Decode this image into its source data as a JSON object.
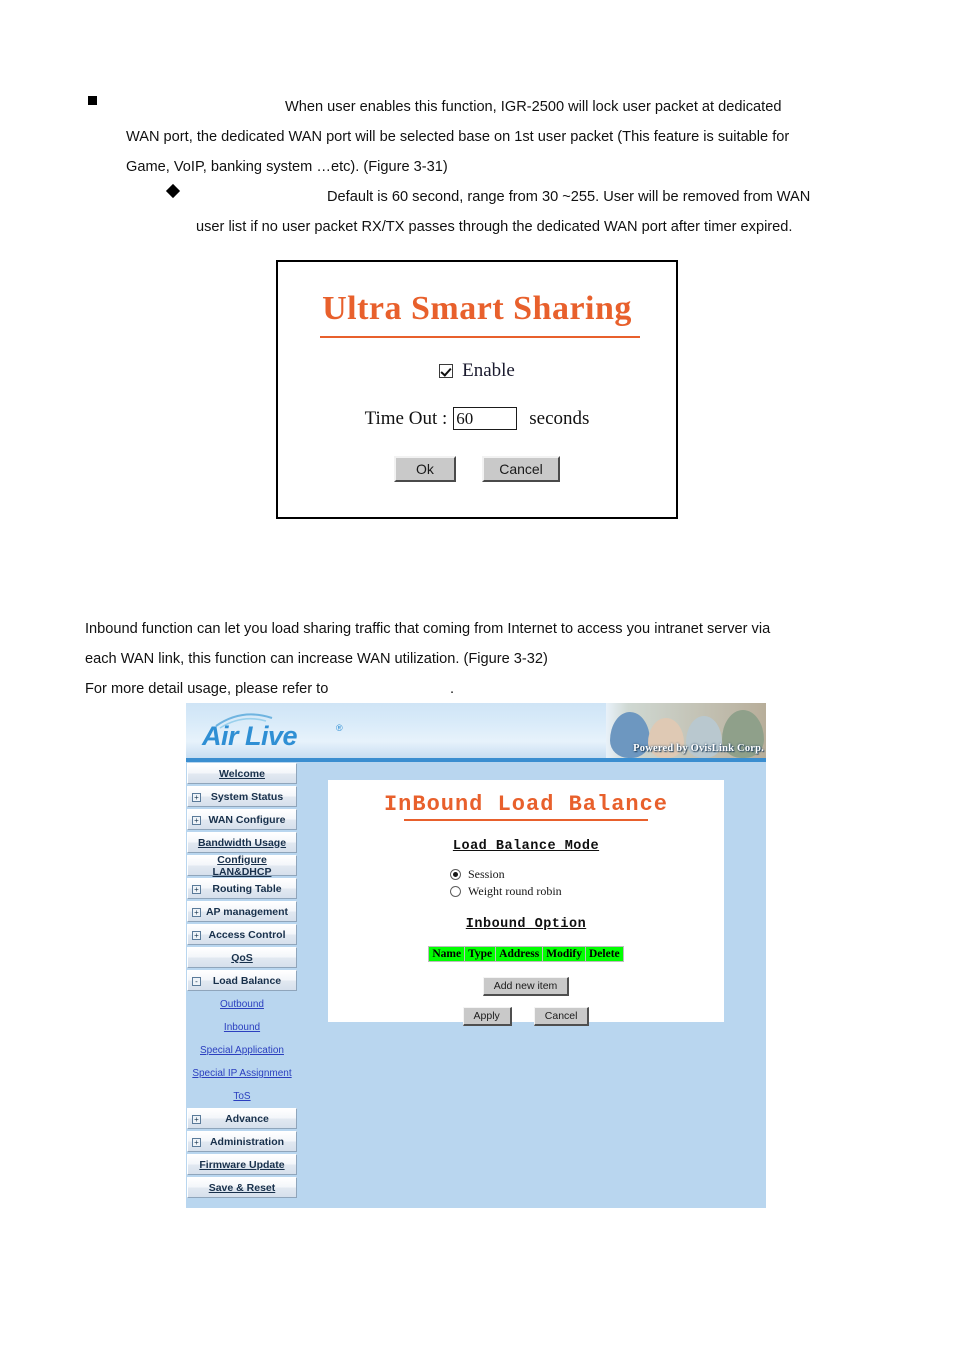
{
  "document": {
    "bullet1": {
      "marker": "square-bullet",
      "line1": "When user enables this function, IGR-2500 will lock user packet at dedicated",
      "line2": "WAN port, the dedicated WAN port will be selected base on 1st user packet (This feature is suitable for",
      "line3": "Game, VoIP, banking system …etc). (Figure 3-31)"
    },
    "bullet2": {
      "marker": "diamond-bullet",
      "line1": "Default is 60 second, range from 30 ~255. User will be removed from WAN",
      "line2": "user list if no user packet RX/TX passes through the dedicated WAN port after timer expired."
    },
    "paragraph2": {
      "line1": "Inbound function can let you load sharing traffic that coming from Internet to access you intranet server via",
      "line2": "each WAN link, this function can increase WAN utilization. (Figure 3-32)",
      "line3": "For more detail usage, please refer to",
      "line3_tail": "."
    }
  },
  "ultra_smart_sharing": {
    "title": "Ultra Smart Sharing",
    "title_color": "#E8602C",
    "enable_label": "Enable",
    "enable_checked": true,
    "timeout_label": "Time Out :",
    "timeout_value": "60",
    "timeout_unit": "seconds",
    "ok_label": "Ok",
    "cancel_label": "Cancel"
  },
  "router_ui": {
    "brand": {
      "logo_text": "Air Live",
      "registered_mark": "®",
      "powered_by": "Powered by OvisLink Corp.",
      "logo_color": "#2f8fd4",
      "page_background": "#b9d6ef"
    },
    "sidebar": {
      "items": [
        {
          "label": "Welcome",
          "type": "button",
          "expander": ""
        },
        {
          "label": "System Status",
          "type": "button",
          "expander": "+"
        },
        {
          "label": "WAN Configure",
          "type": "button",
          "expander": "+"
        },
        {
          "label": "Bandwidth Usage",
          "type": "button",
          "expander": ""
        },
        {
          "label": "Configure LAN&DHCP",
          "type": "button",
          "expander": ""
        },
        {
          "label": "Routing Table",
          "type": "button",
          "expander": "+"
        },
        {
          "label": "AP management",
          "type": "button",
          "expander": "+"
        },
        {
          "label": "Access Control",
          "type": "button",
          "expander": "+"
        },
        {
          "label": "QoS",
          "type": "button",
          "expander": ""
        },
        {
          "label": "Load Balance",
          "type": "button",
          "expander": "-"
        }
      ],
      "sub_items": [
        {
          "label": "Outbound"
        },
        {
          "label": "Inbound"
        },
        {
          "label": "Special Application"
        },
        {
          "label": "Special IP Assignment"
        },
        {
          "label": "ToS"
        }
      ],
      "items_after": [
        {
          "label": "Advance",
          "type": "button",
          "expander": "+"
        },
        {
          "label": "Administration",
          "type": "button",
          "expander": "+"
        },
        {
          "label": "Firmware Update",
          "type": "button",
          "expander": ""
        },
        {
          "label": "Save & Reset",
          "type": "button",
          "expander": ""
        }
      ]
    },
    "main": {
      "page_title": "InBound Load Balance",
      "page_title_color": "#E8602C",
      "mode_heading": "Load Balance Mode",
      "mode_options": [
        {
          "label": "Session",
          "selected": true
        },
        {
          "label": "Weight round robin",
          "selected": false
        }
      ],
      "option_heading": "Inbound Option",
      "table": {
        "headers": [
          "Name",
          "Type",
          "Address",
          "Modify",
          "Delete"
        ],
        "header_background": "#00FF00",
        "rows": []
      },
      "add_button": "Add new item",
      "apply_button": "Apply",
      "cancel_button": "Cancel"
    }
  }
}
